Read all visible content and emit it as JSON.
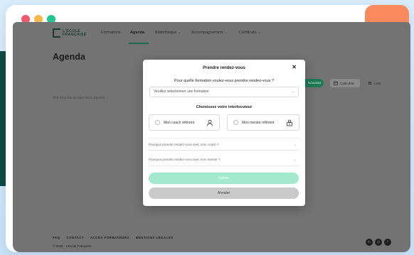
{
  "colors": {
    "dot_red": "#f0596a",
    "dot_yellow": "#f7b84b",
    "dot_green": "#22c592",
    "accent_orange": "#fb8a5e",
    "brand_green": "#1d7a55",
    "submit_disabled": "#a3e9cf"
  },
  "brand": {
    "line1": "L'ÉCOLE",
    "line2": "FRANÇAISE"
  },
  "nav": {
    "items": [
      {
        "label": "Formations",
        "caret": false
      },
      {
        "label": "Agenda",
        "caret": false,
        "active": true
      },
      {
        "label": "Bibliothèque",
        "caret": true
      },
      {
        "label": "Accompagnement",
        "caret": true
      },
      {
        "label": "Certificats",
        "caret": true
      }
    ]
  },
  "page": {
    "title": "Agenda",
    "subtitle": "Voir tous les rendez-vous passés"
  },
  "toolbar": {
    "new_label": "Nouveau",
    "calendar_label": "Calendrier",
    "list_label": "Liste"
  },
  "modal": {
    "title": "Prendre rendez-vous",
    "close_glyph": "✕",
    "question_formation": "Pour quelle formation voulez-vous prendre rendez-vous ?",
    "select_placeholder": "Veuillez sélectionner une formation",
    "question_interlocutor": "Choisissez votre interlocuteur",
    "option_coach": "Mon coach référent",
    "option_mentor": "Mon mentor référent",
    "accordion_coach": "Pourquoi prendre rendez-vous avec mon coach ?",
    "accordion_mentor": "Pourquoi prendre rendez-vous avec mon mentor ?",
    "submit_label": "Valider",
    "cancel_label": "Annuler"
  },
  "footer": {
    "links": [
      "FAQ",
      "CONTACT",
      "ACCÈS FORMATEURS",
      "MENTIONS LÉGALES"
    ],
    "copyright": "© 2025 · L'École Française",
    "social_icons": [
      "linkedin-icon",
      "instagram-icon",
      "facebook-icon"
    ]
  }
}
